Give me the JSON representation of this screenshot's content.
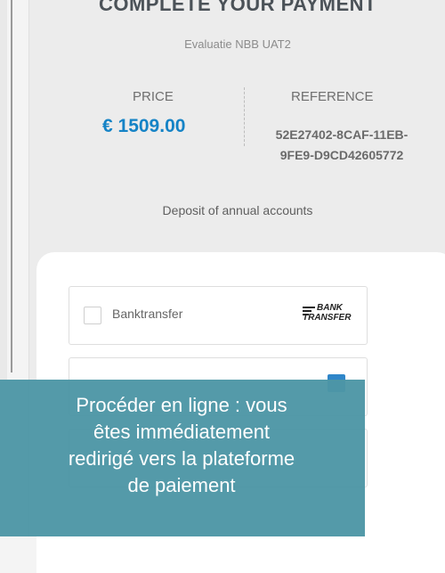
{
  "payment": {
    "title": "COMPLETE YOUR PAYMENT",
    "subtitle": "Evaluatie NBB UAT2",
    "price_label": "PRICE",
    "price_value": "€ 1509.00",
    "reference_label": "REFERENCE",
    "reference_value": "52E27402-8CAF-11EB-9FE9-D9CD42605772",
    "description": "Deposit of annual accounts"
  },
  "methods": [
    {
      "label": "Banktransfer",
      "logo_line1": "BANK",
      "logo_line2": "TRANSFER",
      "checked": false
    },
    {
      "label": "",
      "checked": true
    },
    {
      "label": "",
      "checked": false
    }
  ],
  "tooltip": {
    "text": "Procéder en ligne : vous\nêtes immédiatement\nredirigé vers la plateforme\nde paiement"
  },
  "colors": {
    "accent": "#1583c6",
    "tooltip_bg": "#4d96a5"
  }
}
